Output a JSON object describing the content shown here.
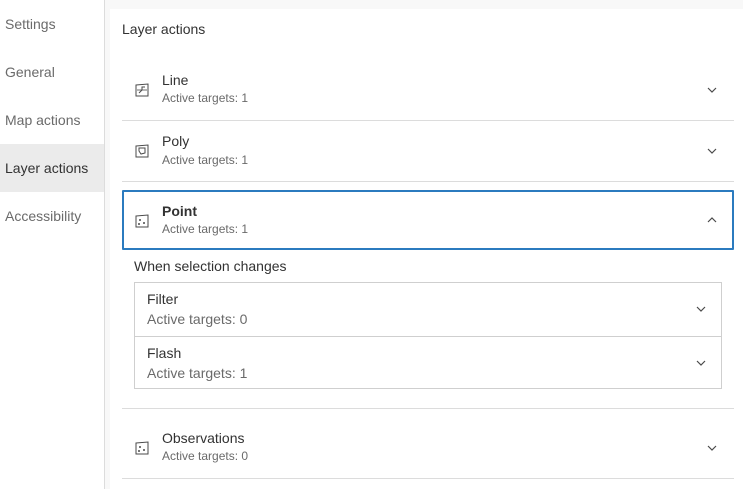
{
  "nav": {
    "items": [
      {
        "label": "Settings"
      },
      {
        "label": "General"
      },
      {
        "label": "Map actions"
      },
      {
        "label": "Layer actions"
      },
      {
        "label": "Accessibility"
      }
    ]
  },
  "panel": {
    "title": "Layer actions",
    "layers": [
      {
        "name": "Line",
        "targets": "Active targets: 1",
        "expanded": false
      },
      {
        "name": "Poly",
        "targets": "Active targets: 1",
        "expanded": false
      },
      {
        "name": "Point",
        "targets": "Active targets: 1",
        "expanded": true
      },
      {
        "name": "Observations",
        "targets": "Active targets: 0",
        "expanded": false
      }
    ],
    "point_section": {
      "label": "When selection changes",
      "actions": [
        {
          "name": "Filter",
          "targets": "Active targets: 0"
        },
        {
          "name": "Flash",
          "targets": "Active targets: 1"
        }
      ]
    }
  },
  "colors": {
    "focus_border": "#2b7bbf",
    "active_nav_bg": "#ebebeb"
  },
  "icons": {
    "line_layer": "line-layer-icon",
    "poly_layer": "polygon-layer-icon",
    "point_layer": "point-layer-icon",
    "chevron_down": "chevron-down-icon",
    "chevron_up": "chevron-up-icon"
  }
}
